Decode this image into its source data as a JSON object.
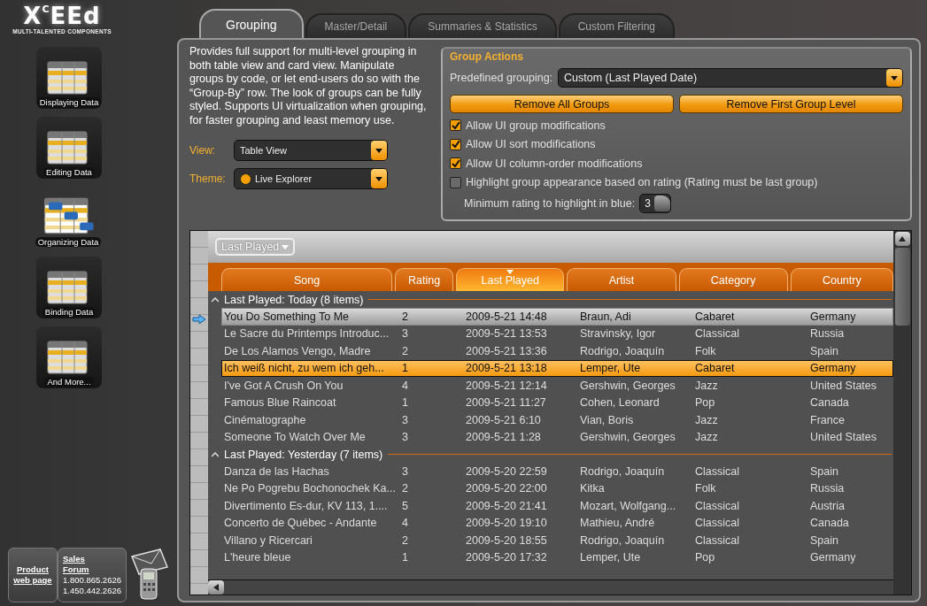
{
  "logo": {
    "name": "X$^{C}$EEd",
    "tagline": "MULTI-TALENTED COMPONENTS"
  },
  "sidebar": {
    "items": [
      {
        "label": "Displaying Data",
        "selected": false
      },
      {
        "label": "Editing Data",
        "selected": false
      },
      {
        "label": "Organizing Data",
        "selected": true
      },
      {
        "label": "Binding Data",
        "selected": false
      },
      {
        "label": "And More...",
        "selected": false
      }
    ],
    "contact": {
      "product_link": "Product web page",
      "sales_link": "Sales",
      "forum_link": "Forum",
      "phones": [
        "1.800.865.2626",
        "1.450.442.2626"
      ]
    }
  },
  "tabs": [
    {
      "label": "Grouping",
      "selected": true
    },
    {
      "label": "Master/Detail",
      "selected": false
    },
    {
      "label": "Summaries & Statistics",
      "selected": false
    },
    {
      "label": "Custom Filtering",
      "selected": false
    }
  ],
  "description": "Provides full support for multi-level grouping in both table view and card view. Manipulate groups by code, or let end-users do so with the “Group-By” row. The look of groups can be fully styled. Supports UI virtualization when grouping, for faster grouping and least memory use.",
  "view": {
    "label": "View:",
    "value": "Table View"
  },
  "theme": {
    "label": "Theme:",
    "value": "Live Explorer",
    "color": "#f5a000"
  },
  "group_actions": {
    "title": "Group Actions",
    "predefined_label": "Predefined grouping:",
    "predefined_value": "Custom (Last Played Date)",
    "buttons": [
      "Remove All Groups",
      "Remove First Group Level"
    ],
    "options": [
      {
        "label": "Allow UI group modifications",
        "checked": true
      },
      {
        "label": "Allow UI sort modifications",
        "checked": true
      },
      {
        "label": "Allow UI column-order modifications",
        "checked": true
      },
      {
        "label": "Highlight group appearance based on rating (Rating must be last group)",
        "checked": false
      }
    ],
    "min_rating_label": "Minimum rating to highlight in blue:",
    "min_rating_value": "3"
  },
  "grid": {
    "group_by": [
      "Last Played"
    ],
    "columns": [
      {
        "label": "Song",
        "sorted": false
      },
      {
        "label": "Rating",
        "sorted": false
      },
      {
        "label": "Last Played",
        "sorted": true
      },
      {
        "label": "Artist",
        "sorted": false
      },
      {
        "label": "Category",
        "sorted": false
      },
      {
        "label": "Country",
        "sorted": false
      }
    ],
    "groups": [
      {
        "title": "Last Played: Today (8 items)",
        "expanded": true,
        "rows": [
          {
            "cells": [
              "You Do Something To Me",
              "2",
              "2009-5-21 14:48",
              "Braun, Adi",
              "Cabaret",
              "Germany"
            ],
            "current": true,
            "selected": false
          },
          {
            "cells": [
              "Le Sacre du Printemps Introduc...",
              "3",
              "2009-5-21 13:53",
              "Stravinsky, Igor",
              "Classical",
              "Russia"
            ],
            "current": false,
            "selected": false
          },
          {
            "cells": [
              "De Los Alamos Vengo, Madre",
              "2",
              "2009-5-21 13:36",
              "Rodrigo, Joaquín",
              "Folk",
              "Spain"
            ],
            "current": false,
            "selected": false
          },
          {
            "cells": [
              "Ich weiß nicht, zu wem ich geh...",
              "1",
              "2009-5-21 13:18",
              "Lemper, Ute",
              "Cabaret",
              "Germany"
            ],
            "current": false,
            "selected": true
          },
          {
            "cells": [
              "I've Got A Crush On You",
              "4",
              "2009-5-21 12:14",
              "Gershwin, Georges",
              "Jazz",
              "United States"
            ],
            "current": false,
            "selected": false
          },
          {
            "cells": [
              "Famous Blue Raincoat",
              "1",
              "2009-5-21 11:27",
              "Cohen, Leonard",
              "Pop",
              "Canada"
            ],
            "current": false,
            "selected": false
          },
          {
            "cells": [
              "Cinématographe",
              "3",
              "2009-5-21 6:10",
              "Vian, Boris",
              "Jazz",
              "France"
            ],
            "current": false,
            "selected": false
          },
          {
            "cells": [
              "Someone To Watch Over Me",
              "3",
              "2009-5-21 1:28",
              "Gershwin, Georges",
              "Jazz",
              "United States"
            ],
            "current": false,
            "selected": false
          }
        ]
      },
      {
        "title": "Last Played: Yesterday (7 items)",
        "expanded": true,
        "rows": [
          {
            "cells": [
              "Danza de las Hachas",
              "3",
              "2009-5-20 22:59",
              "Rodrigo, Joaquín",
              "Classical",
              "Spain"
            ],
            "current": false,
            "selected": false
          },
          {
            "cells": [
              "Ne Po Pogrebu Bochonochek Ka...",
              "2",
              "2009-5-20 22:00",
              "Kitka",
              "Folk",
              "Russia"
            ],
            "current": false,
            "selected": false
          },
          {
            "cells": [
              "Divertimento Es-dur, KV 113, 1....",
              "5",
              "2009-5-20 21:41",
              "Mozart, Wolfgang...",
              "Classical",
              "Austria"
            ],
            "current": false,
            "selected": false
          },
          {
            "cells": [
              "Concerto de Québec - Andante",
              "4",
              "2009-5-20 19:10",
              "Mathieu, André",
              "Classical",
              "Canada"
            ],
            "current": false,
            "selected": false
          },
          {
            "cells": [
              "Villano y Ricercari",
              "2",
              "2009-5-20 18:55",
              "Rodrigo, Joaquín",
              "Classical",
              "Spain"
            ],
            "current": false,
            "selected": false
          },
          {
            "cells": [
              "L'heure bleue",
              "1",
              "2009-5-20 17:32",
              "Lemper, Ute",
              "Pop",
              "Germany"
            ],
            "current": false,
            "selected": false
          }
        ]
      }
    ]
  }
}
